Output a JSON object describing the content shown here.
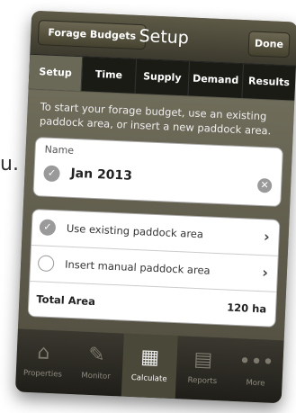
{
  "stray_text": "u.",
  "navbar": {
    "back_label": "Forage Budgets",
    "title": "Setup",
    "done_label": "Done"
  },
  "tabs": [
    {
      "label": "Setup",
      "active": true
    },
    {
      "label": "Time",
      "active": false
    },
    {
      "label": "Supply",
      "active": false
    },
    {
      "label": "Demand",
      "active": false
    },
    {
      "label": "Results",
      "active": false
    }
  ],
  "intro_text": "To start your forage budget, use an existing paddock area, or insert a new paddock area.",
  "name_field": {
    "label": "Name",
    "value": "Jan 2013"
  },
  "options": [
    {
      "label": "Use existing paddock area",
      "checked": true
    },
    {
      "label": "Insert manual paddock area",
      "checked": false
    }
  ],
  "total": {
    "label": "Total Area",
    "value": "120 ha"
  },
  "tabbar": [
    {
      "label": "Properties",
      "icon": "house-icon",
      "active": false
    },
    {
      "label": "Monitor",
      "icon": "pencil-icon",
      "active": false
    },
    {
      "label": "Calculate",
      "icon": "calculator-icon",
      "active": true
    },
    {
      "label": "Reports",
      "icon": "printer-icon",
      "active": false
    },
    {
      "label": "More",
      "icon": "more-dots-icon",
      "active": false
    }
  ]
}
